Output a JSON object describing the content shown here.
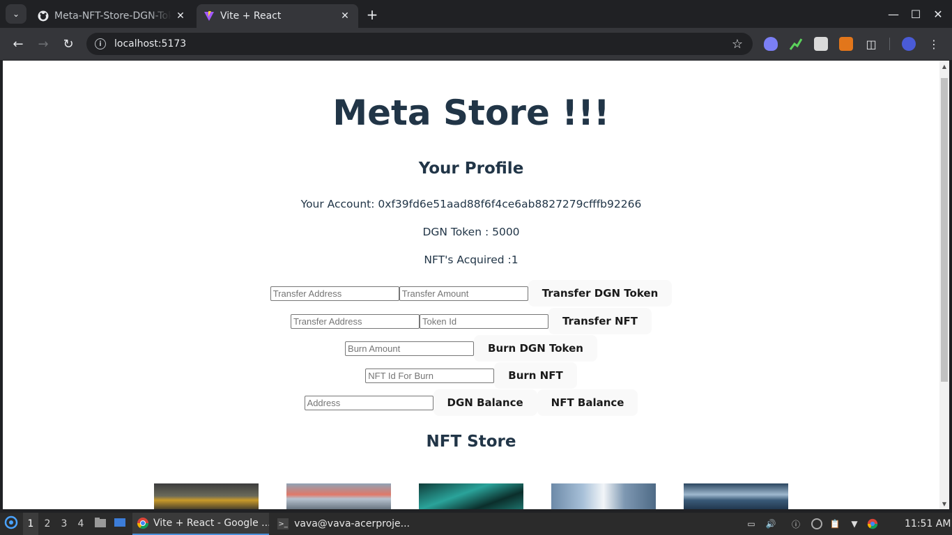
{
  "browser": {
    "tabs": [
      {
        "title": "Meta-NFT-Store-DGN-Token",
        "active": false
      },
      {
        "title": "Vite + React",
        "active": true
      }
    ],
    "url": "localhost:5173"
  },
  "page": {
    "heading": "Meta Store !!!",
    "profile_heading": "Your Profile",
    "account_text": "Your Account: 0xf39fd6e51aad88f6f4ce6ab8827279cfffb92266",
    "dgn_token_text": "DGN Token : 5000",
    "nft_acquired_text": "NFT's Acquired :1",
    "transfer_token": {
      "address_placeholder": "Transfer Address",
      "amount_placeholder": "Transfer Amount",
      "button": "Transfer DGN Token"
    },
    "transfer_nft": {
      "address_placeholder": "Transfer Address",
      "token_placeholder": "Token Id",
      "button": "Transfer NFT"
    },
    "burn_token": {
      "amount_placeholder": "Burn Amount",
      "button": "Burn DGN Token"
    },
    "burn_nft": {
      "id_placeholder": "NFT Id For Burn",
      "button": "Burn NFT"
    },
    "balance": {
      "address_placeholder": "Address",
      "dgn_button": "DGN Balance",
      "nft_button": "NFT Balance"
    },
    "store_heading": "NFT Store"
  },
  "taskbar": {
    "workspaces": [
      "1",
      "2",
      "3",
      "4"
    ],
    "tasks": [
      {
        "label": "Vite + React - Google ...",
        "active": true
      },
      {
        "label": "vava@vava-acerproje...",
        "active": false
      }
    ],
    "clock": "11:51 AM"
  },
  "colors": {
    "text": "#213547",
    "button_bg": "#f9f9f9",
    "browser_dark": "#202124",
    "browser_toolbar": "#35363a"
  }
}
